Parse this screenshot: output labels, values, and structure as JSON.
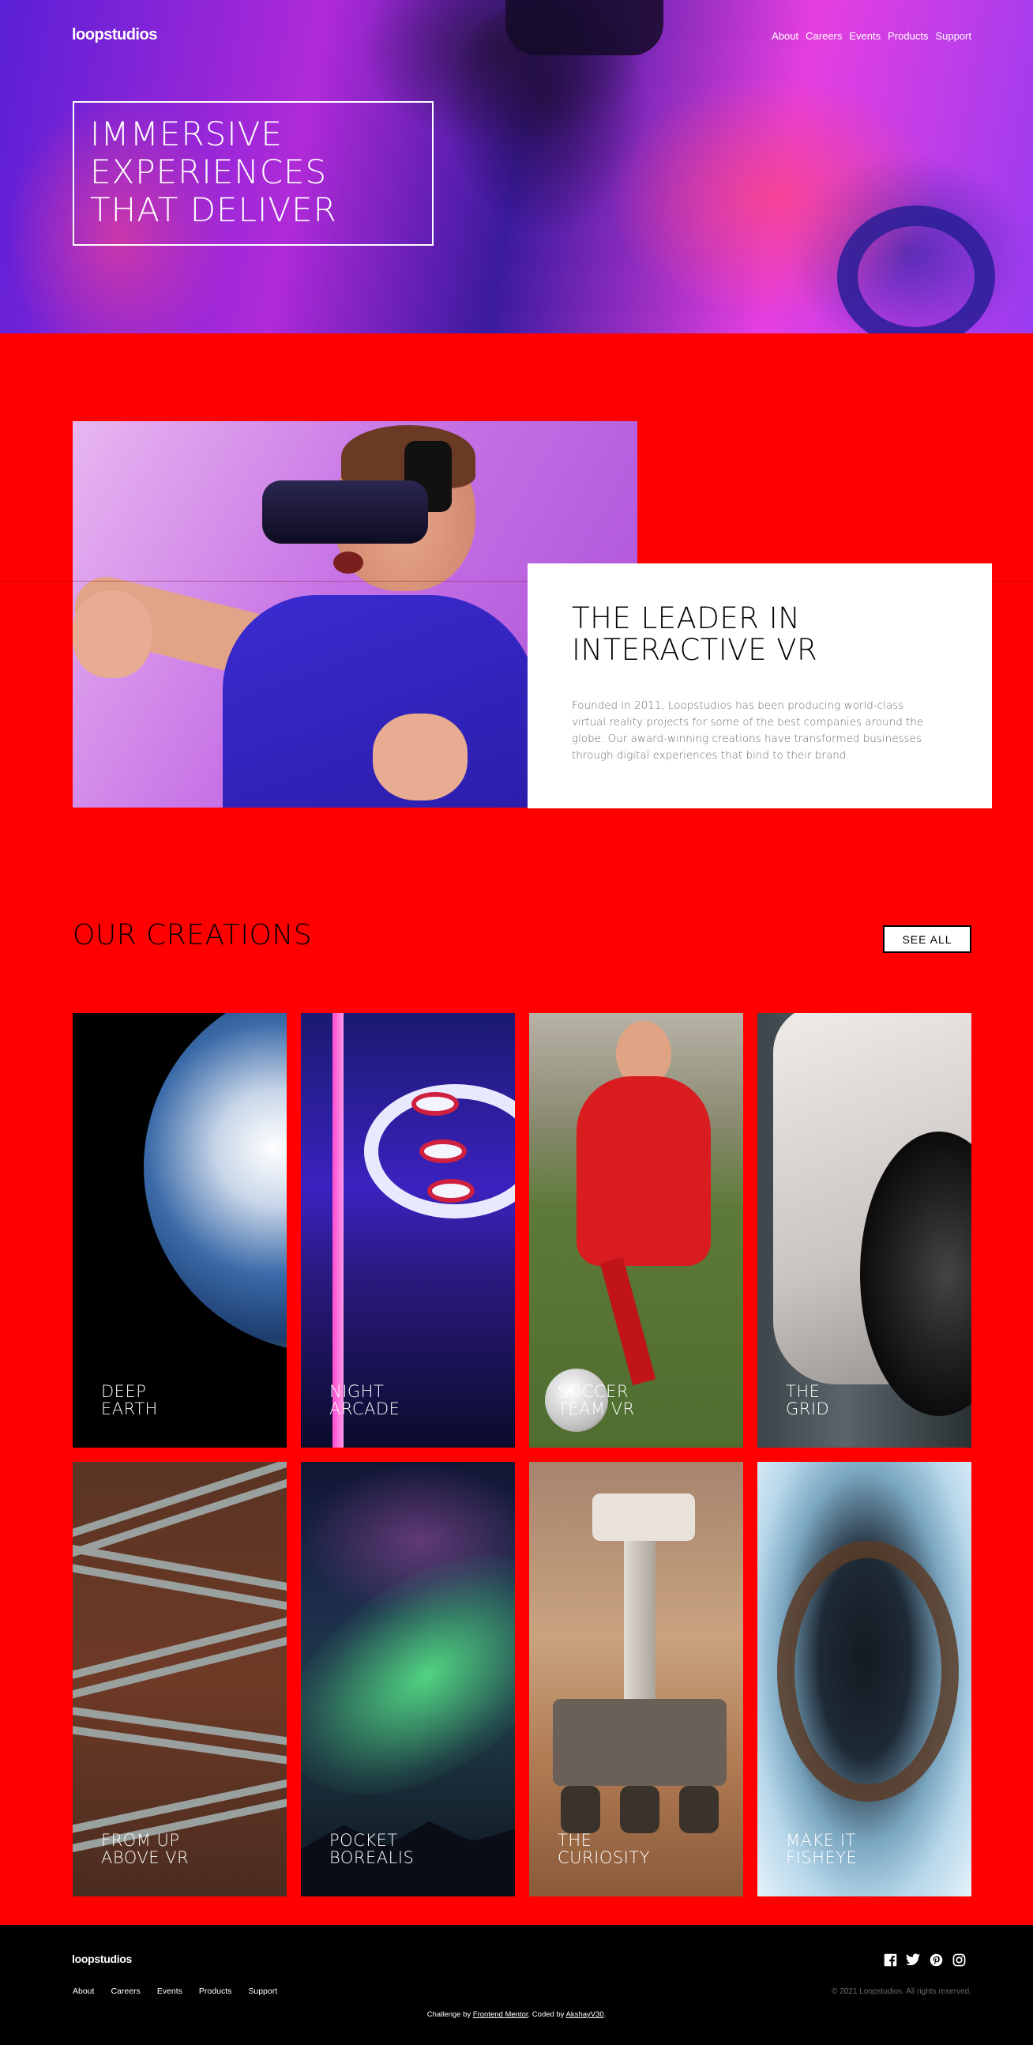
{
  "header": {
    "logo": "loopstudios",
    "nav": [
      "About",
      "Careers",
      "Events",
      "Products",
      "Support"
    ]
  },
  "hero": {
    "title_lines": [
      "IMMERSIVE",
      "EXPERIENCES",
      "THAT DELIVER"
    ]
  },
  "leader": {
    "title_lines": [
      "THE LEADER IN",
      "INTERACTIVE VR"
    ],
    "text": "Founded in 2011, Loopstudios has been producing world-class virtual reality projects for some of the best companies around the globe. Our award-winning creations have transformed businesses through digital experiences that bind to their brand."
  },
  "creations": {
    "title": "OUR CREATIONS",
    "see_all": "SEE ALL",
    "cards": [
      {
        "line1": "DEEP",
        "line2": "EARTH"
      },
      {
        "line1": "NIGHT",
        "line2": "ARCADE"
      },
      {
        "line1": "SOCCER",
        "line2": "TEAM VR"
      },
      {
        "line1": "THE",
        "line2": "GRID"
      },
      {
        "line1": "FROM UP",
        "line2": "ABOVE VR"
      },
      {
        "line1": "POCKET",
        "line2": "BOREALIS"
      },
      {
        "line1": "THE",
        "line2": "CURIOSITY"
      },
      {
        "line1": "MAKE IT",
        "line2": "FISHEYE"
      }
    ]
  },
  "footer": {
    "logo": "loopstudios",
    "nav": [
      "About",
      "Careers",
      "Events",
      "Products",
      "Support"
    ],
    "social_icons": [
      "facebook-icon",
      "twitter-icon",
      "pinterest-icon",
      "instagram-icon"
    ],
    "copyright": "© 2021 Loopstudios. All rights reserved.",
    "credits_prefix": "Challenge by",
    "credits_link1": "Frontend Mentor",
    "credits_mid": ". Coded by",
    "credits_link2": "AkshayV30",
    "credits_suffix": "."
  },
  "colors": {
    "page_background": "#ff0000",
    "footer_background": "#000000",
    "card_background": "#ffffff"
  }
}
